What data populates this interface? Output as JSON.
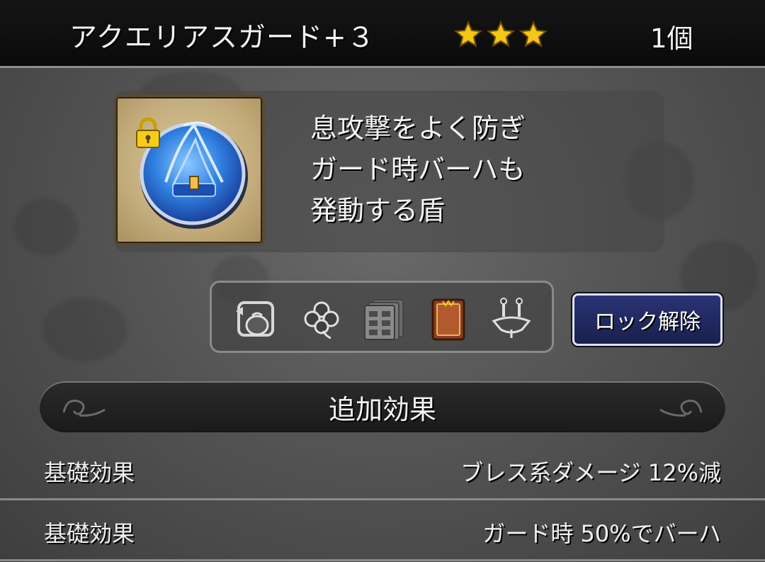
{
  "item": {
    "name": "アクエリアスガード+３",
    "rarity_stars": 3,
    "count": "1個",
    "locked": true
  },
  "description": "息攻撃をよく防ぎ\nガード時バーハも\n発動する盾",
  "category_icons": [
    "bag-icon",
    "clover-icon",
    "dresser-icon",
    "book-icon",
    "hanger-icon"
  ],
  "lock_button": {
    "label": "ロック解除"
  },
  "extra_effects": {
    "title": "追加効果",
    "rows": [
      {
        "label": "基礎効果",
        "value": "ブレス系ダメージ 12%減"
      },
      {
        "label": "基礎効果",
        "value": "ガード時 50%でバーハ"
      }
    ]
  },
  "colors": {
    "star": "#f5c518",
    "shield_blue": "#2f7fe0",
    "button_navy": "#1e2760"
  }
}
